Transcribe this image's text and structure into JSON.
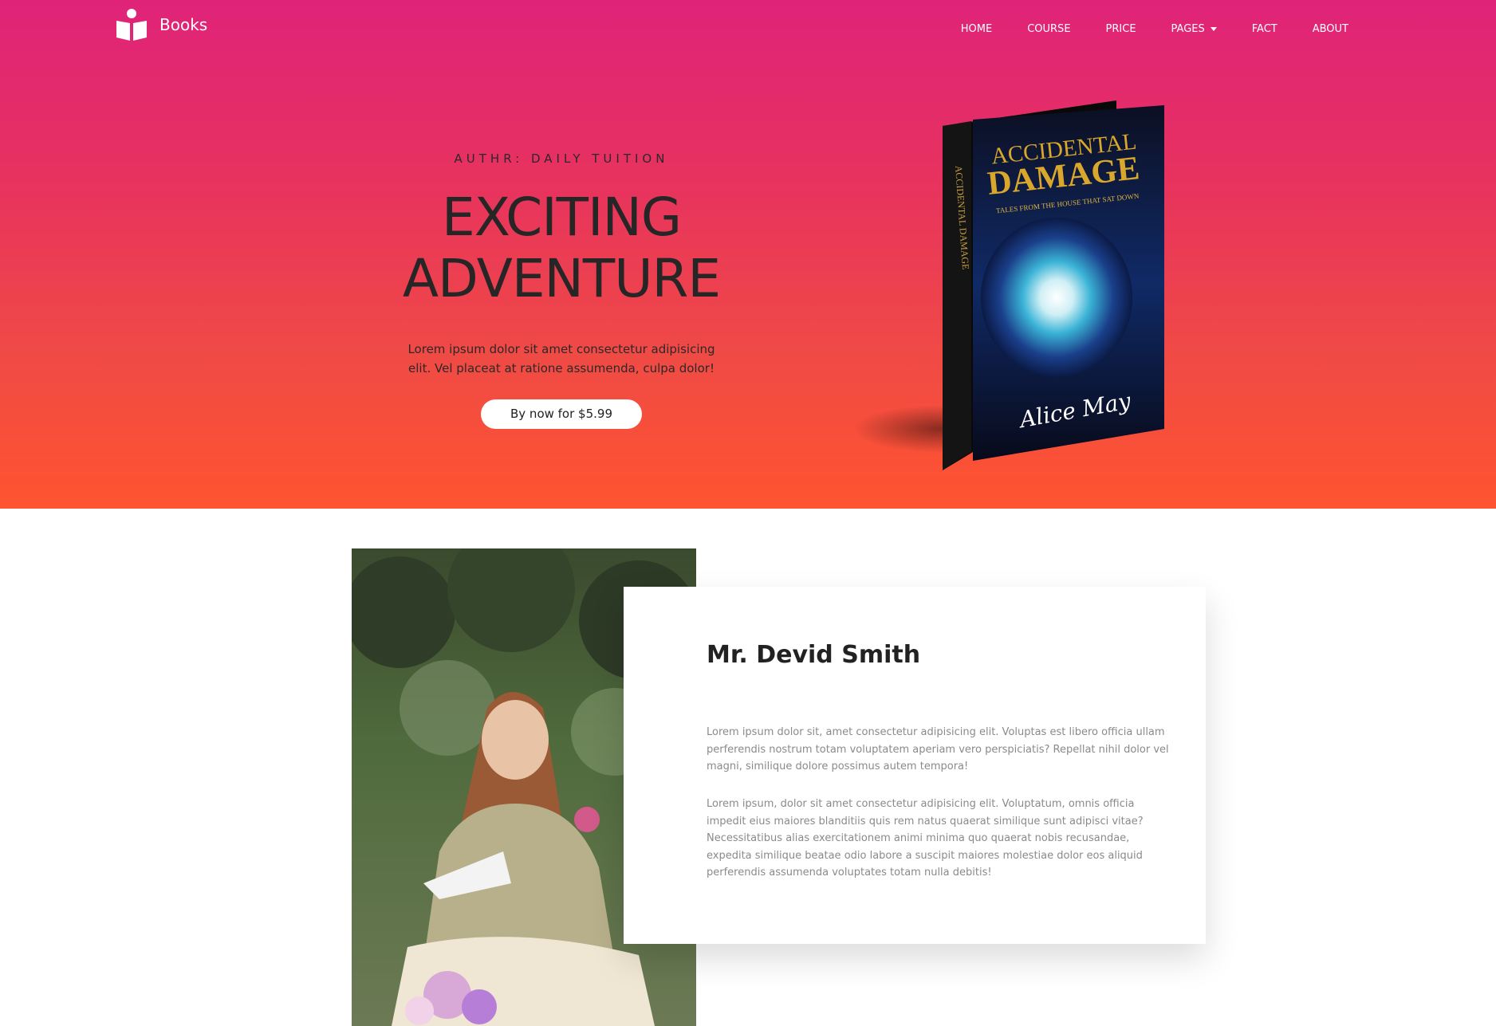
{
  "brand": {
    "name": "Books",
    "icon": "book-reader-icon"
  },
  "nav": {
    "items": [
      "HOME",
      "COURSE",
      "PRICE",
      "PAGES",
      "FACT",
      "ABOUT"
    ]
  },
  "hero": {
    "subtitle": "AUTHR: DAILY TUITION",
    "headline": "EXCITING ADVENTURE",
    "description": "Lorem ipsum dolor sit amet consectetur adipisicing elit. Vel placeat at ratione assumenda, culpa dolor!",
    "button_label": "By now for $5.99",
    "gradient_top": "#df2379",
    "gradient_bottom": "#ff5430"
  },
  "book": {
    "title_line1": "ACCIDENTAL",
    "title_line2": "DAMAGE",
    "tagline": "TALES FROM THE HOUSE THAT SAT DOWN",
    "spine_title": "ACCIDENTAL DAMAGE",
    "author": "Alice May"
  },
  "about": {
    "name": "Mr. Devid Smith",
    "paragraph1": "Lorem ipsum dolor sit, amet consectetur adipisicing elit. Voluptas est libero officia ullam perferendis nostrum totam voluptatem aperiam vero perspiciatis? Repellat nihil dolor vel magni, similique dolore possimus autem tempora!",
    "paragraph2": "Lorem ipsum, dolor sit amet consectetur adipisicing elit. Voluptatum, omnis officia impedit eius maiores blanditiis quis rem natus quaerat similique sunt adipisci vitae? Necessitatibus alias exercitationem animi minima quo quaerat nobis recusandae, expedita similique beatae odio labore a suscipit maiores molestiae dolor eos aliquid perferendis assumenda voluptates totam nulla debitis!"
  }
}
